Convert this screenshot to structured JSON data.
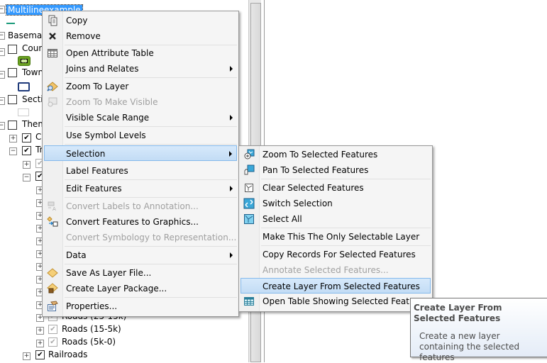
{
  "toc": {
    "rows": [
      {
        "label": "Multilineexample",
        "expander": "minus",
        "checkbox": null,
        "selected": true
      },
      {
        "label": "Basemap",
        "expander": "minus",
        "checkbox": null
      },
      {
        "label": "Counties",
        "expander": "minus",
        "checkbox": "unchecked"
      },
      {
        "label": "Towns",
        "expander": "minus",
        "checkbox": "unchecked"
      },
      {
        "label": "Sections",
        "expander": "minus",
        "checkbox": "unchecked"
      },
      {
        "label": "Theme",
        "expander": "minus",
        "checkbox": "unchecked"
      },
      {
        "label": "C",
        "expander": "plus",
        "checkbox": "checked"
      },
      {
        "label": "Tr",
        "expander": "minus",
        "checkbox": "checked"
      },
      {
        "label": "Roads (25-15k)",
        "expander": "plus",
        "checkbox": "gray"
      },
      {
        "label": "Roads (15-5k)",
        "expander": "plus",
        "checkbox": "gray"
      },
      {
        "label": "Roads (5k-0)",
        "expander": "plus",
        "checkbox": "gray"
      },
      {
        "label": "Railroads",
        "expander": "plus",
        "checkbox": "checked"
      }
    ]
  },
  "context_menu": {
    "items": [
      {
        "label": "Copy",
        "icon": "copy-icon"
      },
      {
        "label": "Remove",
        "icon": "remove-x-icon"
      },
      {
        "label": "Open Attribute Table",
        "icon": "table-icon"
      },
      {
        "label": "Joins and Relates",
        "submenu": true
      },
      {
        "label": "Zoom To Layer",
        "icon": "zoom-to-layer-icon"
      },
      {
        "label": "Zoom To Make Visible",
        "icon": "zoom-visible-icon",
        "disabled": true
      },
      {
        "label": "Visible Scale Range",
        "submenu": true
      },
      {
        "label": "Use Symbol Levels"
      },
      {
        "label": "Selection",
        "submenu": true,
        "highlighted": true
      },
      {
        "label": "Label Features"
      },
      {
        "label": "Edit Features",
        "submenu": true
      },
      {
        "label": "Convert Labels to Annotation...",
        "icon": "convert-labels-icon",
        "disabled": true
      },
      {
        "label": "Convert Features to Graphics...",
        "icon": "convert-graphics-icon"
      },
      {
        "label": "Convert Symbology to Representation...",
        "disabled": true
      },
      {
        "label": "Data",
        "submenu": true
      },
      {
        "label": "Save As Layer File...",
        "icon": "layer-file-icon"
      },
      {
        "label": "Create Layer Package...",
        "icon": "layer-package-icon"
      },
      {
        "label": "Properties...",
        "icon": "properties-icon"
      }
    ]
  },
  "selection_submenu": {
    "items": [
      {
        "label": "Zoom To Selected Features",
        "icon": "zoom-selected-icon"
      },
      {
        "label": "Pan To Selected Features",
        "icon": "pan-selected-icon"
      },
      {
        "label": "Clear Selected Features",
        "icon": "clear-selection-icon"
      },
      {
        "label": "Switch Selection",
        "icon": "switch-selection-icon"
      },
      {
        "label": "Select All",
        "icon": "select-all-icon"
      },
      {
        "label": "Make This The Only Selectable Layer"
      },
      {
        "label": "Copy Records For Selected Features"
      },
      {
        "label": "Annotate Selected Features...",
        "disabled": true
      },
      {
        "label": "Create Layer From Selected Features",
        "highlighted": true
      },
      {
        "label": "Open Table Showing Selected Features",
        "icon": "table-icon"
      }
    ]
  },
  "tooltip": {
    "title": "Create Layer From Selected Features",
    "body": "Create a new layer containing the selected features"
  },
  "colors": {
    "highlight": "#cce4f7",
    "highlight_border": "#84b9ec",
    "selected_layer_bg": "#3399ff",
    "county_symbol": "#6aa121",
    "town_symbol": "#1f3a7a"
  }
}
